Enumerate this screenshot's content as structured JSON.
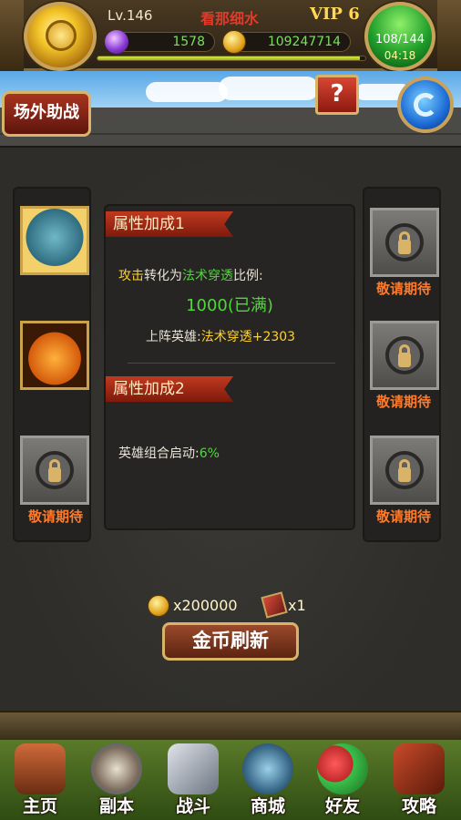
{
  "header": {
    "level": "Lv.146",
    "player_name": "看那细水",
    "vip": "VIP 6",
    "gems": "1578",
    "gold": "109247714",
    "stamina": "108/144",
    "stamina_timer": "04:18",
    "xp_fraction": 0.98
  },
  "buttons": {
    "help": "?",
    "assist_tab": "场外助战"
  },
  "left_slots": {
    "locked_label": "敬请期待"
  },
  "right_slots": {
    "labels": [
      "敬请期待",
      "敬请期待",
      "敬请期待"
    ]
  },
  "bonus1": {
    "title": "属性加成1",
    "line1_prefix": "攻击",
    "line1_mid": "转化为",
    "line1_target": "法术穿透",
    "line1_suffix": "比例:",
    "value": "1000(已满)",
    "line3_prefix": "上阵英雄:",
    "line3_value": "法术穿透+2303"
  },
  "bonus2": {
    "title": "属性加成2",
    "line_prefix": "英雄组合启动:",
    "line_value": "6%"
  },
  "refresh": {
    "gold_cost": "x200000",
    "item_cost": "x1",
    "button": "金币刷新"
  },
  "nav": {
    "items": [
      "主页",
      "副本",
      "战斗",
      "商城",
      "好友",
      "攻略"
    ]
  },
  "colors": {
    "accent_red": "#c0391f",
    "green": "#4fd83a",
    "gold": "#ffd12a",
    "coming_soon": "#ff7a2a"
  }
}
